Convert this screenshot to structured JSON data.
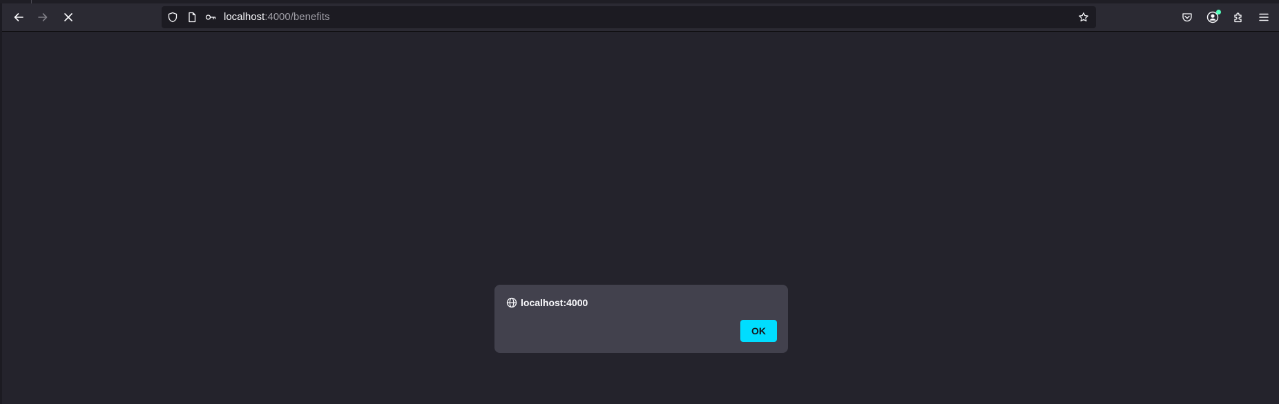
{
  "browser": {
    "url_host": "localhost",
    "url_rest": ":4000/benefits",
    "icons": {
      "back": "back-arrow-icon",
      "forward": "forward-arrow-icon",
      "stop": "stop-loading-icon",
      "shield": "tracking-protection-shield-icon",
      "page": "page-info-icon",
      "key": "key-icon",
      "bookmark": "bookmark-star-icon",
      "pocket": "pocket-icon",
      "account": "account-icon",
      "extensions": "extensions-puzzle-icon",
      "menu": "hamburger-menu-icon"
    }
  },
  "dialog": {
    "origin": "localhost:4000",
    "ok_label": "OK",
    "icon": "globe-icon"
  },
  "colors": {
    "page_background": "#24232c",
    "toolbar": "#2b2a33",
    "urlbar": "#1c1b22",
    "dialog_background": "#42414d",
    "accent": "#00ddff"
  }
}
